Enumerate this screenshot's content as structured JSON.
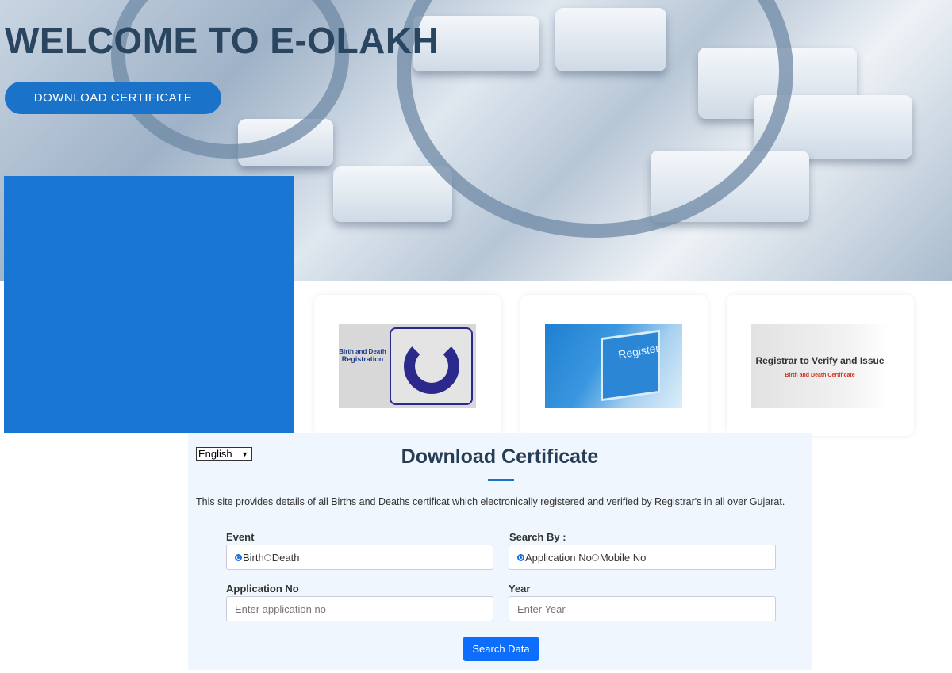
{
  "hero": {
    "title": "WELCOME TO E-OLAKH",
    "download_button": "DOWNLOAD CERTIFICATE"
  },
  "cards": [
    {
      "name": "birth-death-registration-logo",
      "lines": [
        "Birth and Death",
        "Registration"
      ]
    },
    {
      "name": "register-image",
      "text": "Register"
    },
    {
      "name": "registrar-image",
      "title": "Registrar to Verify and Issue",
      "subtitle": "Birth and Death Certificate"
    }
  ],
  "panel": {
    "language": "English",
    "title": "Download Certificate",
    "description": "This site provides details of all Births and Deaths certificat which electronically registered and verified by Registrar's in all over Gujarat.",
    "event_label": "Event",
    "event_options": [
      "Birth",
      "Death"
    ],
    "event_selected": "Birth",
    "search_by_label": "Search By :",
    "search_by_options": [
      "Application No",
      "Mobile No"
    ],
    "search_by_selected": "Application No",
    "application_label": "Application No",
    "application_placeholder": "Enter application no",
    "year_label": "Year",
    "year_placeholder": "Enter Year",
    "search_button": "Search Data"
  },
  "colors": {
    "accent": "#1976d2",
    "button": "#0d6efd",
    "panel_bg": "#f0f6fd",
    "title": "#263d55"
  }
}
